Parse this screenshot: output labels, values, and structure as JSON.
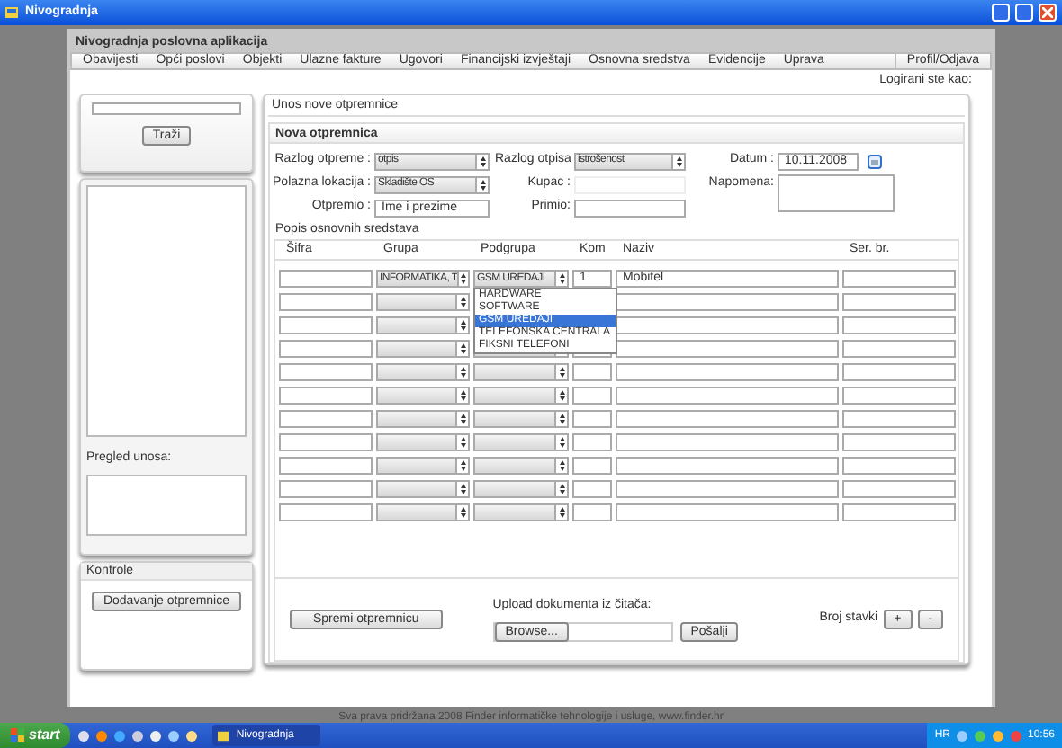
{
  "window": {
    "title": "Nivogradnja"
  },
  "app": {
    "title": "Nivogradnja poslovna aplikacija",
    "menu": [
      "Obavijesti",
      "Opći poslovi",
      "Objekti",
      "Ulazne fakture",
      "Ugovori",
      "Financijski izvještaji",
      "Osnovna sredstva",
      "Evidencije",
      "Uprava"
    ],
    "profile": "Profil/Odjava",
    "logged_in_label": "Logirani ste kao:"
  },
  "sidebar": {
    "search_button": "Traži",
    "preview_label": "Pregled unosa:",
    "controls_title": "Kontrole",
    "add_button": "Dodavanje otpremnice"
  },
  "main": {
    "title": "Unos nove otpremnice",
    "section": "Nova otpremnica",
    "fields": [
      {
        "label": "Razlog otpreme :",
        "kind": "select",
        "value": "otpis"
      },
      {
        "label": "Polazna lokacija :",
        "kind": "select",
        "value": "Skladište OS"
      },
      {
        "label": "Otpremio :",
        "kind": "input",
        "value": "Ime i prezime"
      }
    ],
    "fields_2": [
      {
        "label": "Razlog otpisa",
        "kind": "select",
        "value": "istrošenost"
      },
      {
        "label": "Kupac :",
        "kind": "text"
      },
      {
        "label": "Primio:",
        "kind": "input"
      }
    ],
    "date_label": "Datum :",
    "date": "10.11.2008",
    "note_label": "Napomena:",
    "table_title": "Popis osnovnih sredstava",
    "columns": [
      "Šifra",
      "Grupa",
      "Podgrupa",
      "Kom",
      "Naziv",
      "Ser. br."
    ],
    "rows": [
      {
        "grupa": "INFORMATIKA, T",
        "podgrupa": "GSM UREDAJI",
        "kom": "1",
        "naziv": "Mobitel"
      },
      {},
      {},
      {},
      {},
      {},
      {},
      {},
      {},
      {},
      {}
    ],
    "dropdown": [
      {
        "label": "HARDWARE",
        "selected": false
      },
      {
        "label": "SOFTWARE",
        "selected": false
      },
      {
        "label": "GSM UREDAJI",
        "selected": true
      },
      {
        "label": "TELEFONSKA CENTRALA",
        "selected": false
      },
      {
        "label": "FIKSNI TELEFONI",
        "selected": false
      }
    ],
    "save_button": "Spremi otpremnicu",
    "upload_label": "Upload dokumenta iz čitača:",
    "browse_button": "Browse...",
    "send_button": "Pošalji",
    "count_label": "Broj stavki",
    "plus_button": "+",
    "minus_button": "-"
  },
  "footer": "Sva prava pridržana 2008 Finder informatičke tehnologije i usluge, www.finder.hr",
  "taskbar": {
    "start": "start",
    "task": "Nivogradnja",
    "language": "HR",
    "clock": "10:56"
  }
}
